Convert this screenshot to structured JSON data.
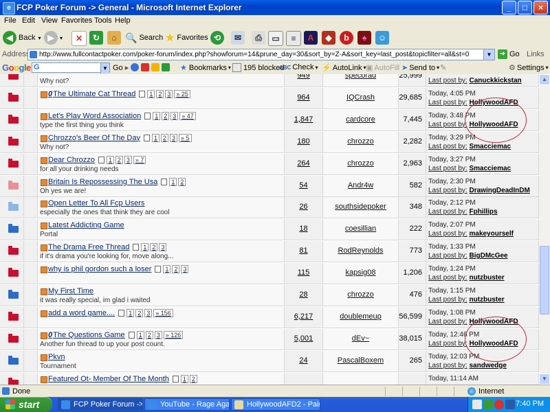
{
  "window": {
    "title": "FCP Poker Forum -> General - Microsoft Internet Explorer",
    "icon": "ie-icon"
  },
  "menu": [
    "File",
    "Edit",
    "View",
    "Favorites",
    "Tools",
    "Help"
  ],
  "toolbar": {
    "back": "Back",
    "search": "Search",
    "favorites": "Favorites"
  },
  "address": {
    "label": "Address",
    "url": "http://www.fullcontactpoker.com/poker-forum/index.php?showforum=14&prune_day=30&sort_by=Z-A&sort_key=last_post&topicfilter=all&st=0",
    "go": "Go",
    "links": "Links"
  },
  "googlebar": {
    "logo": "Google",
    "go": "Go",
    "bookmarks": "Bookmarks",
    "blocked": "195 blocked",
    "check": "Check",
    "autolink": "AutoLink",
    "autofill": "AutoFill",
    "sendto": "Send to",
    "settings": "Settings"
  },
  "topics": [
    {
      "folder": "red",
      "title": "",
      "pin": false,
      "pages": [],
      "desc": "Why not?",
      "replies": "949",
      "author": "specbrad",
      "views": "25,999",
      "time": "",
      "lastby": "Canuckkickstan",
      "circled": false
    },
    {
      "folder": "red",
      "title": "The Ultimate Cat Thread",
      "pin": true,
      "pages": [
        "1",
        "2",
        "3",
        "» 25"
      ],
      "desc": "",
      "replies": "964",
      "author": "IQCrash",
      "views": "29,685",
      "time": "Today, 4:05 PM",
      "lastby": "HollywoodAFD",
      "circled": true
    },
    {
      "folder": "red",
      "title": "Let's Play Word Association",
      "pin": false,
      "pages": [
        "1",
        "2",
        "3",
        "» 47"
      ],
      "desc": "type the first thing you think",
      "replies": "1,847",
      "author": "cardcore",
      "views": "7,445",
      "time": "Today, 3:48 PM",
      "lastby": "HollywoodAFD",
      "circled": true
    },
    {
      "folder": "red",
      "title": "Chrozzo's Beer Of The Day",
      "pin": false,
      "pages": [
        "1",
        "2",
        "3",
        "» 5"
      ],
      "desc": "Why not?",
      "replies": "180",
      "author": "chrozzo",
      "views": "2,282",
      "time": "Today, 3:29 PM",
      "lastby": "Smacciemac",
      "circled": false
    },
    {
      "folder": "red",
      "title": "Dear Chrozzo",
      "pin": false,
      "pages": [
        "1",
        "2",
        "3",
        "» 7"
      ],
      "desc": "for all your drinking needs",
      "replies": "264",
      "author": "chrozzo",
      "views": "2,963",
      "time": "Today, 3:27 PM",
      "lastby": "Smacciemac",
      "circled": false
    },
    {
      "folder": "pink",
      "title": "Britain Is Repossessing The Usa",
      "pin": false,
      "pages": [
        "1",
        "2"
      ],
      "desc": "Oh yes we are!",
      "replies": "54",
      "author": "Andr4w",
      "views": "582",
      "time": "Today, 2:30 PM",
      "lastby": "DrawingDeadInDM",
      "circled": false
    },
    {
      "folder": "lightblue",
      "title": "Open Letter To All Fcp Users",
      "pin": false,
      "pages": [],
      "desc": "especially the ones that think they are cool",
      "replies": "26",
      "author": "southsidepoker",
      "views": "348",
      "time": "Today, 2:12 PM",
      "lastby": "Fphillips",
      "circled": false
    },
    {
      "folder": "blue",
      "title": "Latest Addicting Game",
      "pin": false,
      "pages": [],
      "desc": "Portal",
      "replies": "18",
      "author": "coesillian",
      "views": "222",
      "time": "Today, 2:07 PM",
      "lastby": "makeyourself",
      "circled": false
    },
    {
      "folder": "red",
      "title": "The Drama Free Thread",
      "pin": false,
      "pages": [
        "1",
        "2",
        "3"
      ],
      "desc": "if it's drama you're looking for, move along...",
      "replies": "81",
      "author": "RodReynolds",
      "views": "773",
      "time": "Today, 1:33 PM",
      "lastby": "BigDMcGee",
      "circled": false
    },
    {
      "folder": "red",
      "title": "why is phil gordon such a loser",
      "pin": false,
      "pages": [
        "1",
        "2",
        "3"
      ],
      "desc": "",
      "replies": "115",
      "author": "kapsig08",
      "views": "1,206",
      "time": "Today, 1:24 PM",
      "lastby": "nutzbuster",
      "circled": false
    },
    {
      "folder": "blue",
      "title": "My First Time",
      "pin": false,
      "pages": [],
      "desc": "it was really special, im glad i waited",
      "replies": "28",
      "author": "chrozzo",
      "views": "476",
      "time": "Today, 1:15 PM",
      "lastby": "nutzbuster",
      "circled": false
    },
    {
      "folder": "red",
      "title": "add a word game....",
      "pin": false,
      "pages": [
        "1",
        "2",
        "3",
        "» 156"
      ],
      "desc": "",
      "replies": "6,217",
      "author": "doublemeup",
      "views": "56,599",
      "time": "Today, 1:08 PM",
      "lastby": "HollywoodAFD",
      "circled": true
    },
    {
      "folder": "red",
      "title": "The Questions Game",
      "pin": true,
      "pages": [
        "1",
        "2",
        "3",
        "» 126"
      ],
      "desc": "Another fun thread to up your post count.",
      "replies": "5,001",
      "author": "dEv~",
      "views": "38,015",
      "time": "Today, 12:46 PM",
      "lastby": "HollywoodAFD",
      "circled": true
    },
    {
      "folder": "blue",
      "title": "Pkvn",
      "pin": false,
      "pages": [],
      "desc": "Tournament",
      "replies": "24",
      "author": "PascalBoxem",
      "views": "265",
      "time": "Today, 12:03 PM",
      "lastby": "sandwedge",
      "circled": false
    },
    {
      "folder": "red",
      "title": "Featured Ot- Member Of The Month",
      "pin": false,
      "pages": [
        "1",
        "2"
      ],
      "desc": "",
      "replies": "",
      "author": "",
      "views": "",
      "time": "Today, 11:14 AM",
      "lastby": "",
      "circled": false
    }
  ],
  "lastpost_label": "Last post by:",
  "status": {
    "text": "Done",
    "zone": "Internet"
  },
  "taskbar": {
    "start": "start",
    "tasks": [
      "FCP Poker Forum -> ...",
      "YouTube - Rage Agai...",
      "HollywoodAFD2 - Paint"
    ],
    "clock": "7:40 PM"
  },
  "colors": {
    "folder_red": "#C8102E",
    "folder_pink": "#E8909A",
    "folder_blue": "#2E6BC8",
    "folder_lightblue": "#8FB6E8",
    "circle": "#C0283A",
    "xp_blue": "#0A5FE8"
  }
}
